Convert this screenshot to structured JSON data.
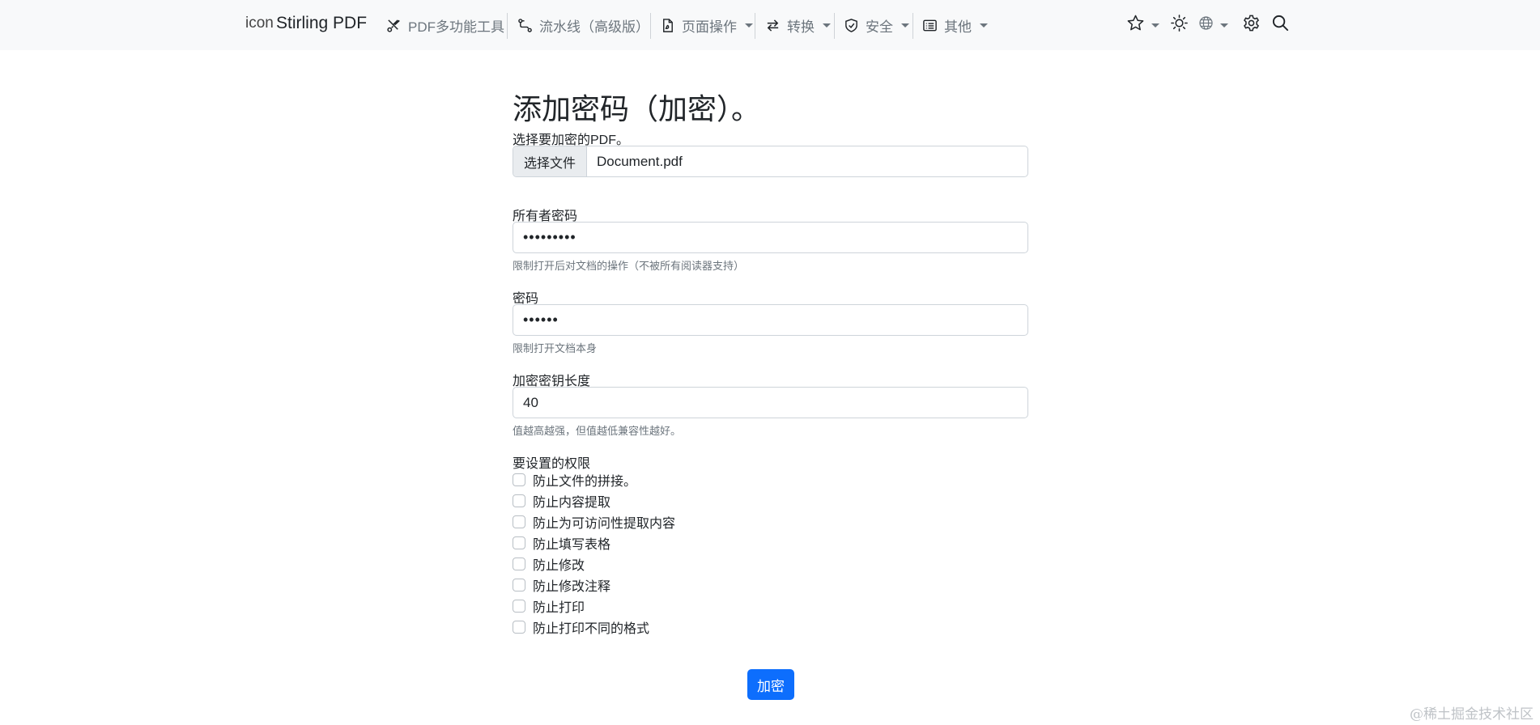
{
  "navbar": {
    "logo_alt": "icon",
    "brand": "Stirling PDF",
    "items": [
      {
        "label": "PDF多功能工具",
        "icon": "scissors-tools-icon",
        "dropdown": false
      },
      {
        "label": "流水线（高级版）",
        "icon": "pipeline-icon",
        "dropdown": false
      },
      {
        "label": "页面操作",
        "icon": "file-pdf-icon",
        "dropdown": true
      },
      {
        "label": "转换",
        "icon": "arrow-left-right-icon",
        "dropdown": true
      },
      {
        "label": "安全",
        "icon": "shield-icon",
        "dropdown": true
      },
      {
        "label": "其他",
        "icon": "card-list-icon",
        "dropdown": true
      }
    ],
    "right_icons": [
      "star-icon",
      "sun-icon",
      "globe-icon",
      "gear-icon",
      "search-icon"
    ]
  },
  "form": {
    "title": "添加密码（加密）。",
    "file": {
      "label": "选择要加密的PDF。",
      "button": "选择文件",
      "filename": "Document.pdf"
    },
    "owner_password": {
      "label": "所有者密码",
      "value": "•••••••••",
      "help": "限制打开后对文档的操作（不被所有阅读器支持）"
    },
    "password": {
      "label": "密码",
      "value": "••••••",
      "help": "限制打开文档本身"
    },
    "key_length": {
      "label": "加密密钥长度",
      "value": "40",
      "help": "值越高越强，但值越低兼容性越好。"
    },
    "permissions": {
      "label": "要设置的权限",
      "items": [
        "防止文件的拼接。",
        "防止内容提取",
        "防止为可访问性提取内容",
        "防止填写表格",
        "防止修改",
        "防止修改注释",
        "防止打印",
        "防止打印不同的格式"
      ]
    },
    "submit": "加密"
  },
  "watermark": "@稀土掘金技术社区",
  "colors": {
    "primary": "#0d6efd",
    "navbar_bg": "#f8f9fa",
    "muted_text": "#6c757d"
  }
}
